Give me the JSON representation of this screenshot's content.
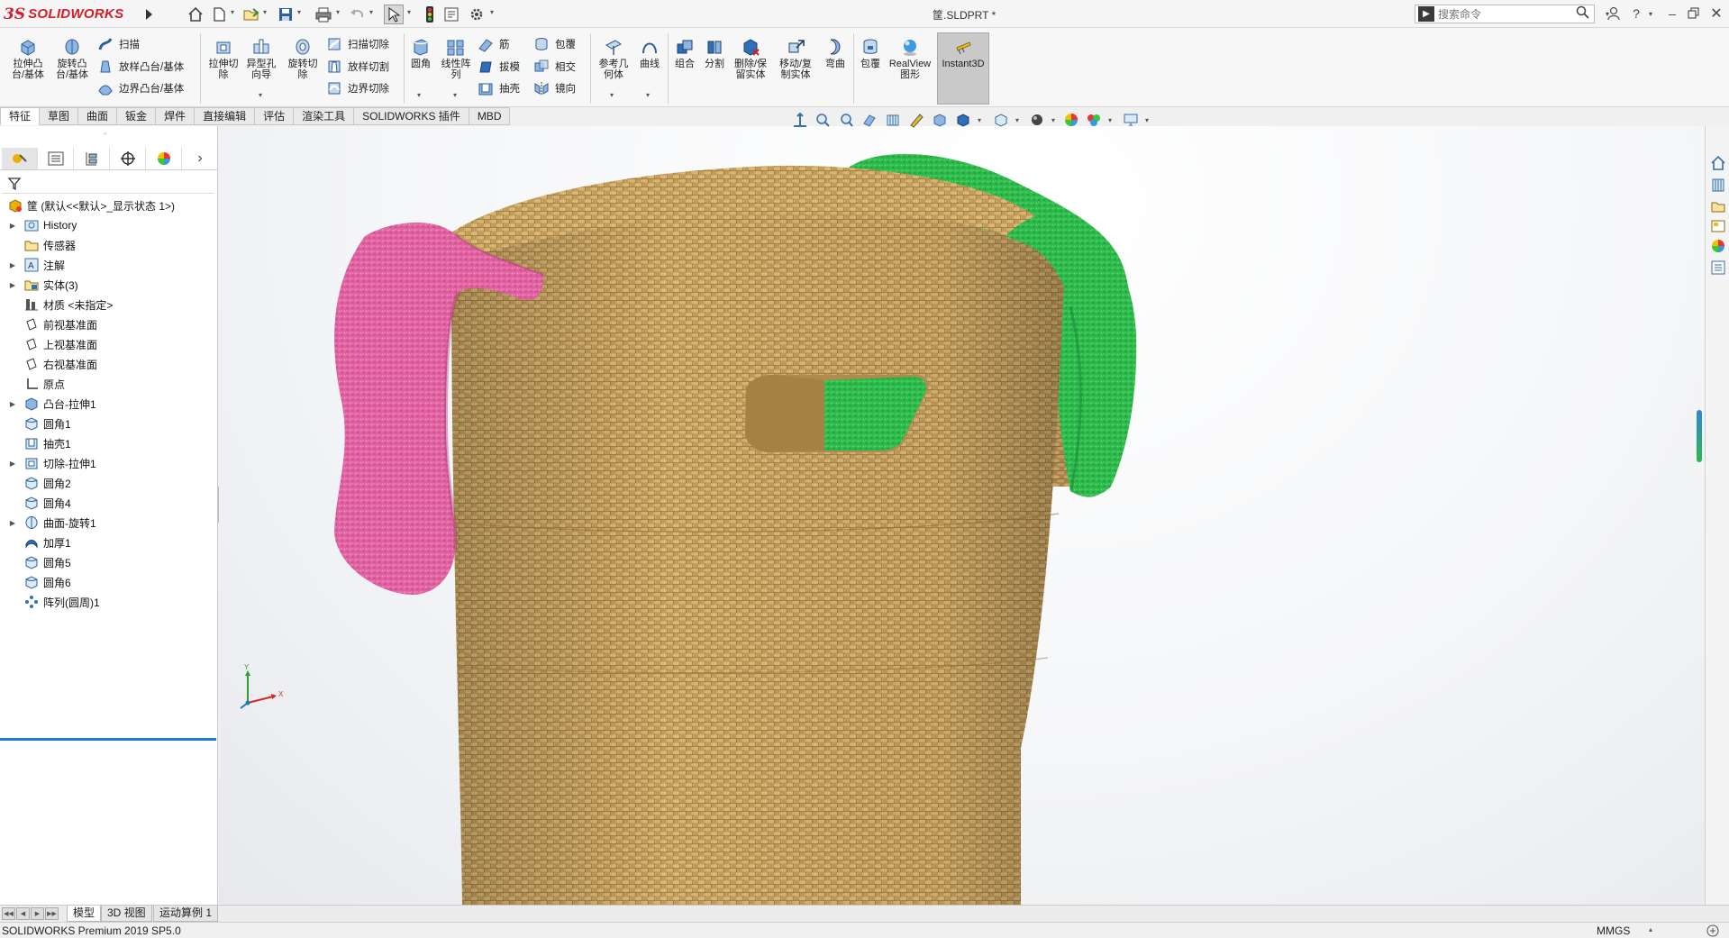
{
  "app": {
    "logo_mark": "3S",
    "logo_text": "SOLIDWORKS",
    "document_title": "筐.SLDPRT *",
    "search_placeholder": "搜索命令"
  },
  "quick_access": [
    "home-icon",
    "new-icon",
    "open-icon",
    "save-icon",
    "print-icon",
    "undo-icon",
    "select-icon",
    "rebuild-icon",
    "file-properties-icon",
    "options-icon"
  ],
  "ribbon": {
    "extrude_boss": "拉伸凸\n台/基体",
    "revolve_boss": "旋转凸\n台/基体",
    "sweep": "扫描",
    "loft_boss": "放样凸台/基体",
    "boundary_boss": "边界凸台/基体",
    "extrude_cut": "拉伸切\n除",
    "hole_wizard": "异型孔\n向导",
    "revolve_cut": "旋转切\n除",
    "swept_cut": "扫描切除",
    "lofted_cut": "放样切割",
    "boundary_cut": "边界切除",
    "fillet": "圆角",
    "linear_pattern": "线性阵\n列",
    "rib": "筋",
    "draft": "拔模",
    "shell": "抽壳",
    "wrap": "包覆",
    "intersect": "相交",
    "mirror": "镜向",
    "reference_geometry": "参考几\n何体",
    "curves": "曲线",
    "combine": "组合",
    "split": "分割",
    "delete_keep_body": "删除/保\n留实体",
    "move_copy_body": "移动/复\n制实体",
    "flex": "弯曲",
    "wrap2": "包覆",
    "realview": "RealView\n图形",
    "instant3d": "Instant3D"
  },
  "command_tabs": [
    "特征",
    "草图",
    "曲面",
    "钣金",
    "焊件",
    "直接编辑",
    "评估",
    "渲染工具",
    "SOLIDWORKS 插件",
    "MBD"
  ],
  "active_command_tab": "特征",
  "feature_tree": {
    "root": "筐  (默认<<默认>_显示状态 1>)",
    "items": [
      {
        "label": "History",
        "icon": "history-folder-icon",
        "expandable": true
      },
      {
        "label": "传感器",
        "icon": "sensor-folder-icon",
        "expandable": false
      },
      {
        "label": "注解",
        "icon": "annotations-icon",
        "expandable": true
      },
      {
        "label": "实体(3)",
        "icon": "solid-bodies-icon",
        "expandable": true
      },
      {
        "label": "材质 <未指定>",
        "icon": "material-icon",
        "expandable": false
      },
      {
        "label": "前视基准面",
        "icon": "plane-icon",
        "expandable": false
      },
      {
        "label": "上视基准面",
        "icon": "plane-icon",
        "expandable": false
      },
      {
        "label": "右视基准面",
        "icon": "plane-icon",
        "expandable": false
      },
      {
        "label": "原点",
        "icon": "origin-icon",
        "expandable": false
      },
      {
        "label": "凸台-拉伸1",
        "icon": "boss-extrude-icon",
        "expandable": true
      },
      {
        "label": "圆角1",
        "icon": "fillet-icon",
        "expandable": false
      },
      {
        "label": "抽壳1",
        "icon": "shell-icon",
        "expandable": false
      },
      {
        "label": "切除-拉伸1",
        "icon": "cut-extrude-icon",
        "expandable": true
      },
      {
        "label": "圆角2",
        "icon": "fillet-icon",
        "expandable": false
      },
      {
        "label": "圆角4",
        "icon": "fillet-icon",
        "expandable": false
      },
      {
        "label": "曲面-旋转1",
        "icon": "surface-revolve-icon",
        "expandable": true
      },
      {
        "label": "加厚1",
        "icon": "thicken-icon",
        "expandable": false
      },
      {
        "label": "圆角5",
        "icon": "fillet-icon",
        "expandable": false
      },
      {
        "label": "圆角6",
        "icon": "fillet-icon",
        "expandable": false
      },
      {
        "label": "阵列(圆周)1",
        "icon": "circular-pattern-icon",
        "expandable": false
      }
    ]
  },
  "bottom_tabs": [
    "模型",
    "3D 视图",
    "运动算例 1"
  ],
  "active_bottom_tab": "模型",
  "status": {
    "product": "SOLIDWORKS Premium 2019 SP5.0",
    "units": "MMGS"
  },
  "triad": {
    "x": "X",
    "y": "Y"
  },
  "colors": {
    "brand_red": "#d2202a",
    "towel_pink": "#e0609f",
    "towel_green": "#2cb94a",
    "wicker": "#c8a466",
    "accent_blue": "#1f7bd6"
  }
}
